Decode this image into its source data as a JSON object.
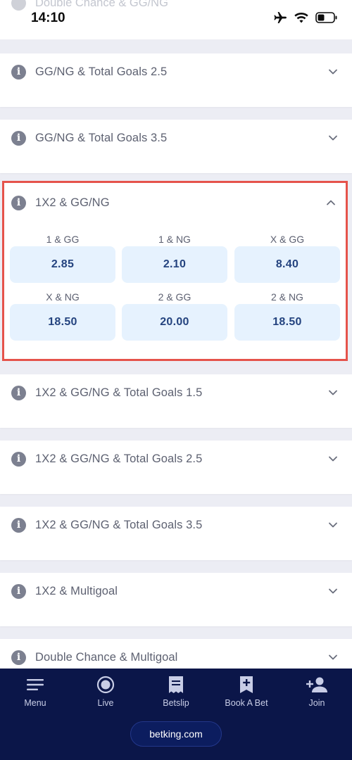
{
  "status_bar": {
    "time": "14:10",
    "partial_market_title": "Double Chance & GG/NG"
  },
  "markets": [
    {
      "title": "GG/NG & Total Goals 2.5",
      "expanded": false
    },
    {
      "title": "GG/NG & Total Goals 3.5",
      "expanded": false
    },
    {
      "title": "1X2 & GG/NG",
      "expanded": true,
      "selections": [
        {
          "label": "1 & GG",
          "odds": "2.85"
        },
        {
          "label": "1 & NG",
          "odds": "2.10"
        },
        {
          "label": "X & GG",
          "odds": "8.40"
        },
        {
          "label": "X & NG",
          "odds": "18.50"
        },
        {
          "label": "2 & GG",
          "odds": "20.00"
        },
        {
          "label": "2 & NG",
          "odds": "18.50"
        }
      ]
    },
    {
      "title": "1X2 & GG/NG & Total Goals 1.5",
      "expanded": false
    },
    {
      "title": "1X2 & GG/NG & Total Goals 2.5",
      "expanded": false
    },
    {
      "title": "1X2 & GG/NG & Total Goals 3.5",
      "expanded": false
    },
    {
      "title": "1X2 & Multigoal",
      "expanded": false
    },
    {
      "title": "Double Chance & Multigoal",
      "expanded": false
    }
  ],
  "nav": {
    "items": [
      {
        "label": "Menu",
        "icon": "menu-icon"
      },
      {
        "label": "Live",
        "icon": "live-icon"
      },
      {
        "label": "Betslip",
        "icon": "betslip-icon"
      },
      {
        "label": "Book A Bet",
        "icon": "book-a-bet-icon"
      },
      {
        "label": "Join",
        "icon": "join-icon"
      }
    ],
    "domain": "betking.com"
  },
  "colors": {
    "nav_bg": "#0b1649",
    "odds_bg": "#e6f2fe",
    "odds_text": "#24437f",
    "highlight_border": "#e5534b"
  }
}
